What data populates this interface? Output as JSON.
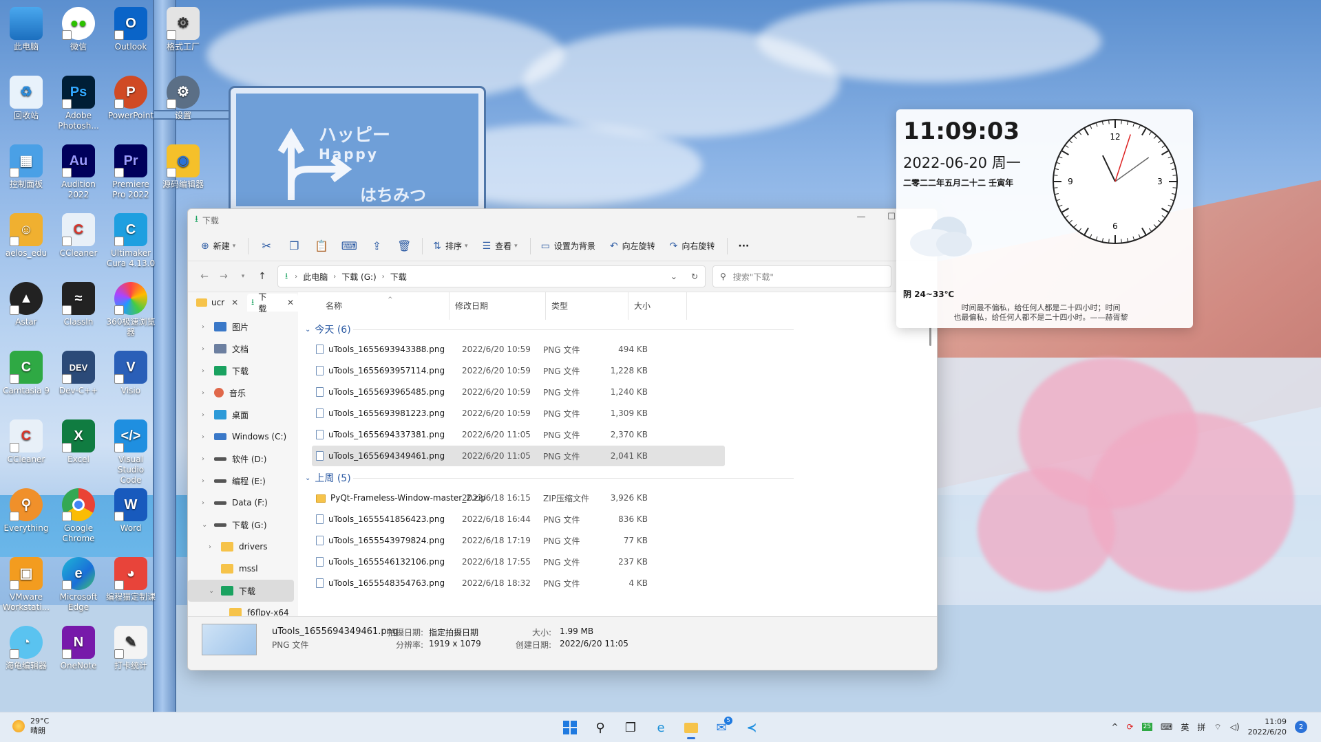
{
  "desktop": {
    "icons": [
      {
        "label": "此电脑"
      },
      {
        "label": "微信"
      },
      {
        "label": "Outlook"
      },
      {
        "label": "格式工厂"
      },
      {
        "label": "回收站"
      },
      {
        "label": "Adobe Photosh..."
      },
      {
        "label": "PowerPoint"
      },
      {
        "label": "设置"
      },
      {
        "label": "控制面板"
      },
      {
        "label": "Audition 2022"
      },
      {
        "label": "Premiere Pro 2022"
      },
      {
        "label": "源码编辑器"
      },
      {
        "label": "aelos_edu"
      },
      {
        "label": "CCleaner"
      },
      {
        "label": "Ultimaker Cura 4.13.0"
      },
      {
        "label": "Astar"
      },
      {
        "label": "ClassIn"
      },
      {
        "label": "360极速浏览器"
      },
      {
        "label": "Camtasia 9"
      },
      {
        "label": "Dev-C++"
      },
      {
        "label": "Visio"
      },
      {
        "label": "CCleaner"
      },
      {
        "label": "Excel"
      },
      {
        "label": "Visual Studio Code"
      },
      {
        "label": "Everything"
      },
      {
        "label": "Google Chrome"
      },
      {
        "label": "Word"
      },
      {
        "label": "VMware Workstati..."
      },
      {
        "label": "Microsoft Edge"
      },
      {
        "label": "编程猫定制课"
      },
      {
        "label": "海龟编辑器"
      },
      {
        "label": "OneNote"
      },
      {
        "label": "打卡统计"
      }
    ],
    "icon_glyphs": [
      "Ps",
      "P",
      "Au",
      "Pr",
      "DEV",
      "V",
      "X",
      "W",
      "N"
    ]
  },
  "wallpaper": {
    "sign_line1": "ハッピー",
    "sign_line2": "Happy",
    "sign_line3": "はちみつ"
  },
  "explorer": {
    "title": "下载",
    "toolbar": {
      "new_label": "新建",
      "sort_label": "排序",
      "view_label": "查看",
      "set_bg_label": "设置为背景",
      "rotate_left_label": "向左旋转",
      "rotate_right_label": "向右旋转",
      "more_label": "···"
    },
    "address": {
      "crumbs": [
        "此电脑",
        "下载 (G:)",
        "下载"
      ],
      "search_placeholder": "搜索\"下载\""
    },
    "tabs": [
      {
        "label": "ucr"
      },
      {
        "label": "下载"
      }
    ],
    "tree": [
      {
        "label": "图片",
        "color": "#3a78c8"
      },
      {
        "label": "文档",
        "color": "#6c7fa0"
      },
      {
        "label": "下载",
        "color": "#1aa260"
      },
      {
        "label": "音乐",
        "color": "#e0684a"
      },
      {
        "label": "桌面",
        "color": "#2d9ad8"
      },
      {
        "label": "Windows (C:)",
        "color": "#3a78c8"
      },
      {
        "label": "软件 (D:)",
        "color": "#555555"
      },
      {
        "label": "编程 (E:)",
        "color": "#555555"
      },
      {
        "label": "Data (F:)",
        "color": "#555555"
      },
      {
        "label": "下载 (G:)",
        "color": "#555555"
      },
      {
        "label": "drivers",
        "color": "#f6c34a"
      },
      {
        "label": "mssl",
        "color": "#f6c34a"
      },
      {
        "label": "下载",
        "color": "#1aa260"
      },
      {
        "label": "f6flpy-x64",
        "color": "#f6c34a"
      }
    ],
    "columns": {
      "name": "名称",
      "modified": "修改日期",
      "type": "类型",
      "size": "大小"
    },
    "groups": [
      {
        "label": "今天 (6)",
        "files": [
          {
            "name": "uTools_1655693943388.png",
            "date": "2022/6/20 10:59",
            "type": "PNG 文件",
            "size": "494 KB"
          },
          {
            "name": "uTools_1655693957114.png",
            "date": "2022/6/20 10:59",
            "type": "PNG 文件",
            "size": "1,228 KB"
          },
          {
            "name": "uTools_1655693965485.png",
            "date": "2022/6/20 10:59",
            "type": "PNG 文件",
            "size": "1,240 KB"
          },
          {
            "name": "uTools_1655693981223.png",
            "date": "2022/6/20 10:59",
            "type": "PNG 文件",
            "size": "1,309 KB"
          },
          {
            "name": "uTools_1655694337381.png",
            "date": "2022/6/20 11:05",
            "type": "PNG 文件",
            "size": "2,370 KB"
          },
          {
            "name": "uTools_1655694349461.png",
            "date": "2022/6/20 11:05",
            "type": "PNG 文件",
            "size": "2,041 KB"
          }
        ]
      },
      {
        "label": "上周 (5)",
        "files": [
          {
            "name": "PyQt-Frameless-Window-master_2.zip",
            "date": "2022/6/18 16:15",
            "type": "ZIP压缩文件",
            "size": "3,926 KB"
          },
          {
            "name": "uTools_1655541856423.png",
            "date": "2022/6/18 16:44",
            "type": "PNG 文件",
            "size": "836 KB"
          },
          {
            "name": "uTools_1655543979824.png",
            "date": "2022/6/18 17:19",
            "type": "PNG 文件",
            "size": "77 KB"
          },
          {
            "name": "uTools_1655546132106.png",
            "date": "2022/6/18 17:55",
            "type": "PNG 文件",
            "size": "237 KB"
          },
          {
            "name": "uTools_1655548354763.png",
            "date": "2022/6/18 18:32",
            "type": "PNG 文件",
            "size": "4 KB"
          }
        ]
      }
    ],
    "details": {
      "filename": "uTools_1655694349461.png",
      "filetype": "PNG 文件",
      "shot_date_label": "拍摄日期:",
      "shot_date_value": "指定拍摄日期",
      "resolution_label": "分辨率:",
      "resolution_value": "1919 x 1079",
      "size_label": "大小:",
      "size_value": "1.99 MB",
      "created_label": "创建日期:",
      "created_value": "2022/6/20 11:05"
    }
  },
  "widget": {
    "time": "11:09:03",
    "date": "2022-06-20 周一",
    "lunar": "二零二二年五月二十二 壬寅年",
    "weather": "阴 24~33℃",
    "quote_line1": "时间最不偏私，给任何人都是二十四小时；时间",
    "quote_line2": "也最偏私，给任何人都不是二十四小时。——赫胥黎",
    "clock_numbers": [
      "12",
      "3",
      "6",
      "9"
    ],
    "clock_time": {
      "hours": 11,
      "minutes": 9,
      "seconds": 3
    }
  },
  "taskbar": {
    "weather_temp": "29°C",
    "weather_desc": "晴朗",
    "tray_ime1": "英",
    "tray_ime2": "拼",
    "tray_battery": "25",
    "mail_badge": "5",
    "clock_time": "11:09",
    "clock_date": "2022/6/20",
    "notification_count": "2"
  }
}
